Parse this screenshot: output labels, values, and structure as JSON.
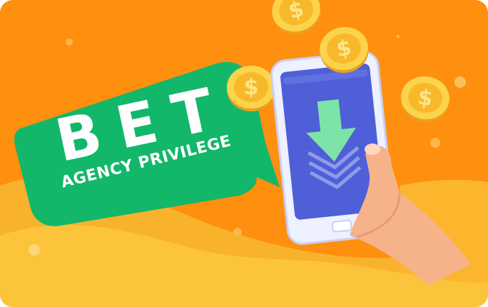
{
  "banner": {
    "headline": "BET",
    "subheadline": "AGENCY PRIVILEGE"
  },
  "colors": {
    "background": "#ff8f0e",
    "wave_light": "#fcc43a",
    "wave_mid": "#f9b22b",
    "bubble": "#12b76a",
    "phone_body": "#eef1ff",
    "phone_screen": "#4e5fd8",
    "download_arrow": "#7de3a8",
    "coin": "#fcd34d",
    "skin": "#f6b38a"
  },
  "icons": {
    "download": "download-arrow-icon",
    "coin": "dollar-coin-icon"
  }
}
